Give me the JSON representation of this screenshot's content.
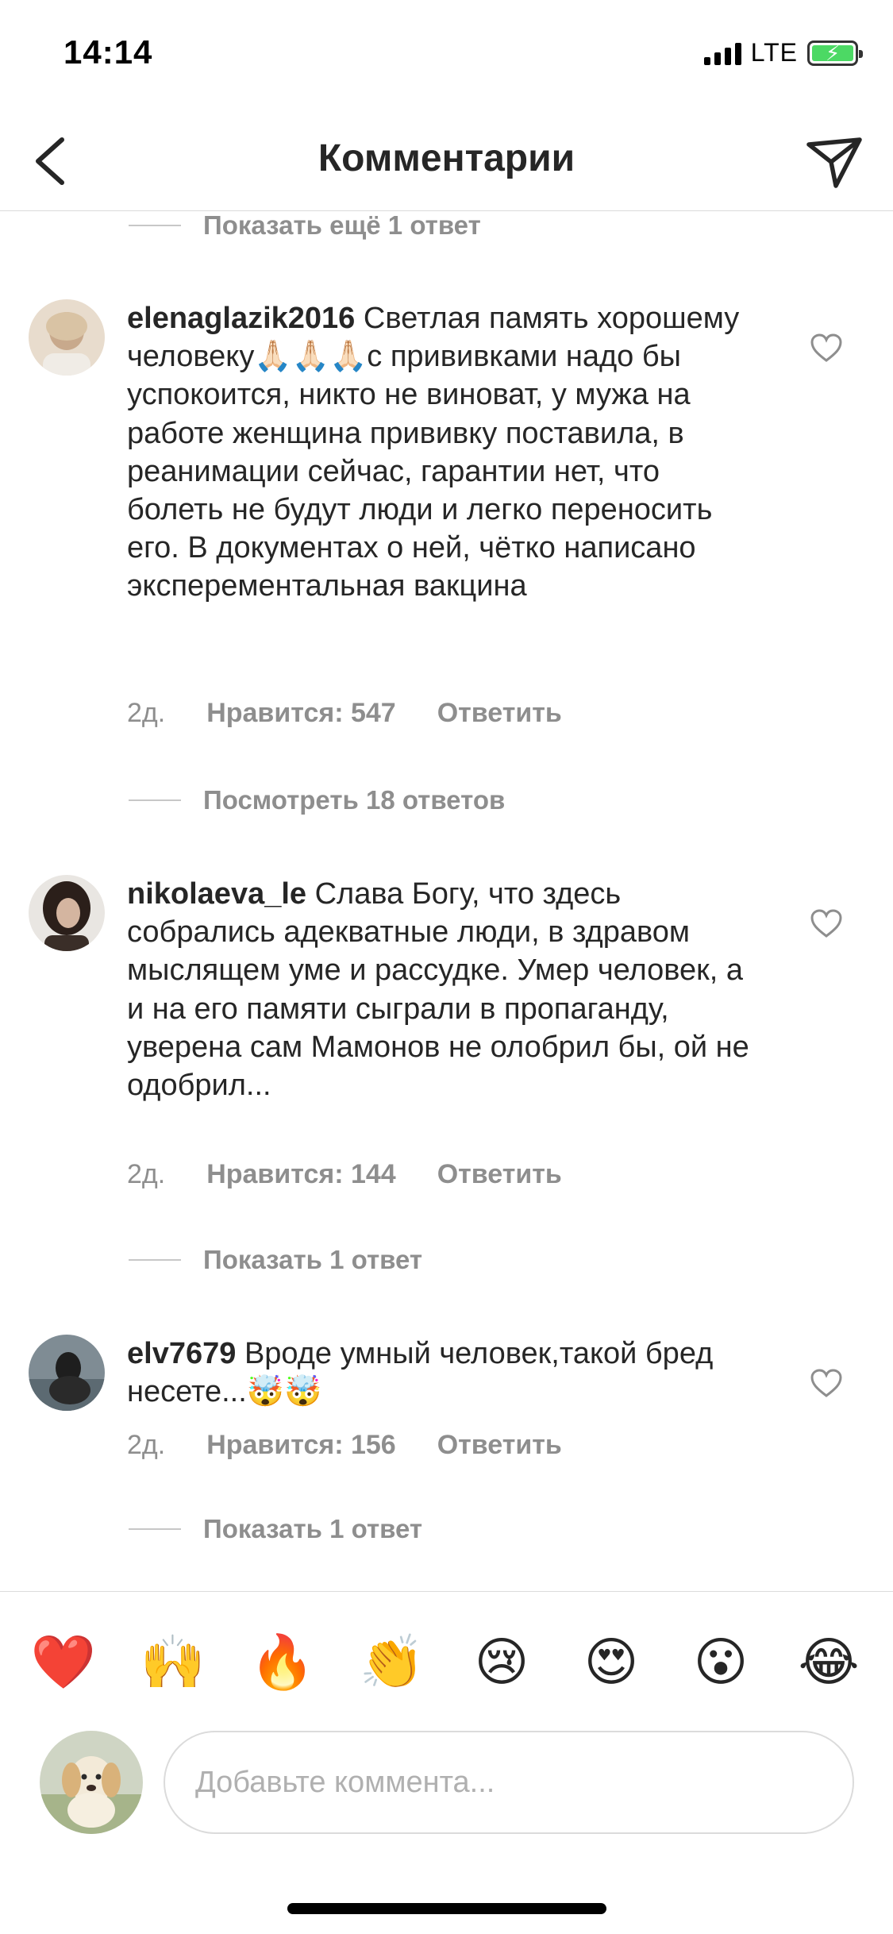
{
  "status_bar": {
    "time": "14:14",
    "network": "LTE"
  },
  "header": {
    "title": "Комментарии"
  },
  "comments": [
    {
      "username": "elenaglazik2016",
      "text": "Светлая память хорошему человеку🙏🏻🙏🏻🙏🏻с прививками надо бы успокоится, никто не виноват, у мужа на работе женщина прививку поставила, в реанимации сейчас,  гарантии нет, что болеть не будут люди и легко переносить его. В документах о ней, чётко написано эксперементальная вакцина",
      "time": "2д.",
      "likes": "Нравится: 547",
      "reply": "Ответить",
      "thread": "Посмотреть 18 ответов"
    },
    {
      "username": "nikolaeva_le",
      "text": "Слава Богу, что здесь собрались адекватные люди, в здравом мыслящем уме и рассудке. Умер человек, а и на его памяти сыграли в пропаганду, уверена сам Мамонов не олобрил бы, ой не одобрил...",
      "time": "2д.",
      "likes": "Нравится: 144",
      "reply": "Ответить",
      "thread": "Показать 1 ответ"
    },
    {
      "username": "elv7679",
      "text": "Вроде умный человек,такой бред несете...🤯🤯",
      "time": "2д.",
      "likes": "Нравится: 156",
      "reply": "Ответить",
      "thread": "Показать 1 ответ"
    }
  ],
  "top_thread": "Показать ещё 1 ответ",
  "reactions": [
    "❤️",
    "🙌",
    "🔥",
    "👏",
    "😢",
    "😍",
    "😮",
    "😂"
  ],
  "composer": {
    "placeholder": "Добавьте коммента..."
  },
  "colors": {
    "muted": "#8e8e8e",
    "divider": "#dbdbdb",
    "text": "#262626"
  }
}
